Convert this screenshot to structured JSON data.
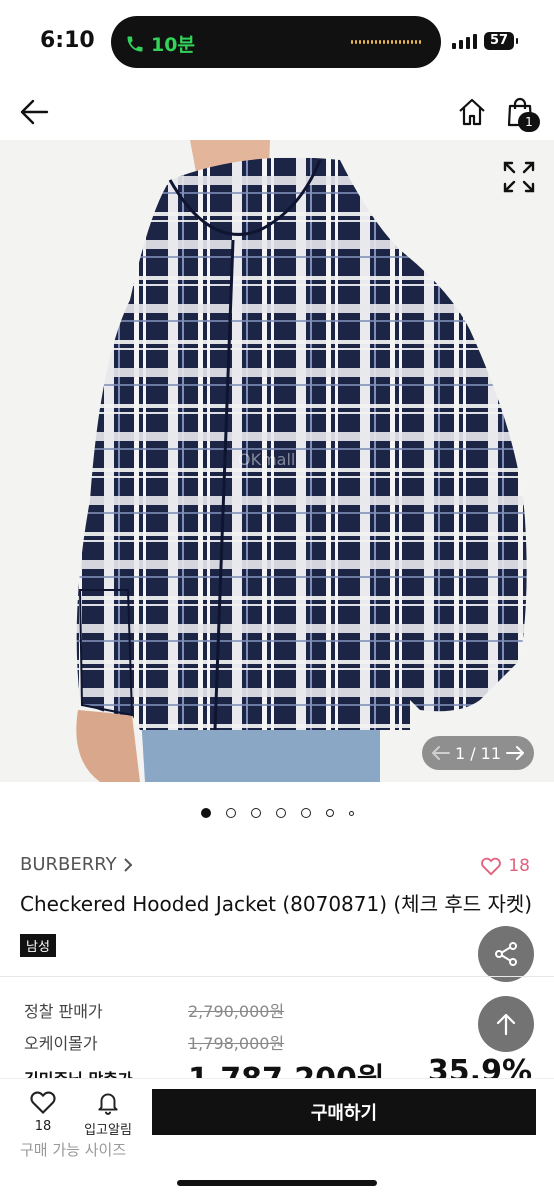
{
  "status_bar": {
    "time": "6:10",
    "call_label": "10분",
    "battery": "57"
  },
  "header": {
    "cart_count": "1"
  },
  "gallery": {
    "counter": "1 / 11",
    "watermark": "OKmall"
  },
  "product": {
    "brand": "BURBERRY",
    "like_count": "18",
    "title": "Checkered Hooded Jacket (8070871) (체크 후드 자켓)",
    "gender_tag": "남성"
  },
  "pricing": {
    "list_label": "정찰 판매가",
    "list_price": "2,790,000원",
    "okmall_label": "오케이몰가",
    "okmall_price": "1,798,000원",
    "member_label": "김민준님 맞춤가",
    "member_price": "1,787,200원",
    "discount": "35.9%",
    "sizes_label": "구매 가능 사이즈"
  },
  "bottom": {
    "wish_count": "18",
    "restock_label": "입고알림",
    "buy_label": "구매하기"
  },
  "colors": {
    "badge_red": "#e2617d",
    "navy": "#1c2545"
  }
}
